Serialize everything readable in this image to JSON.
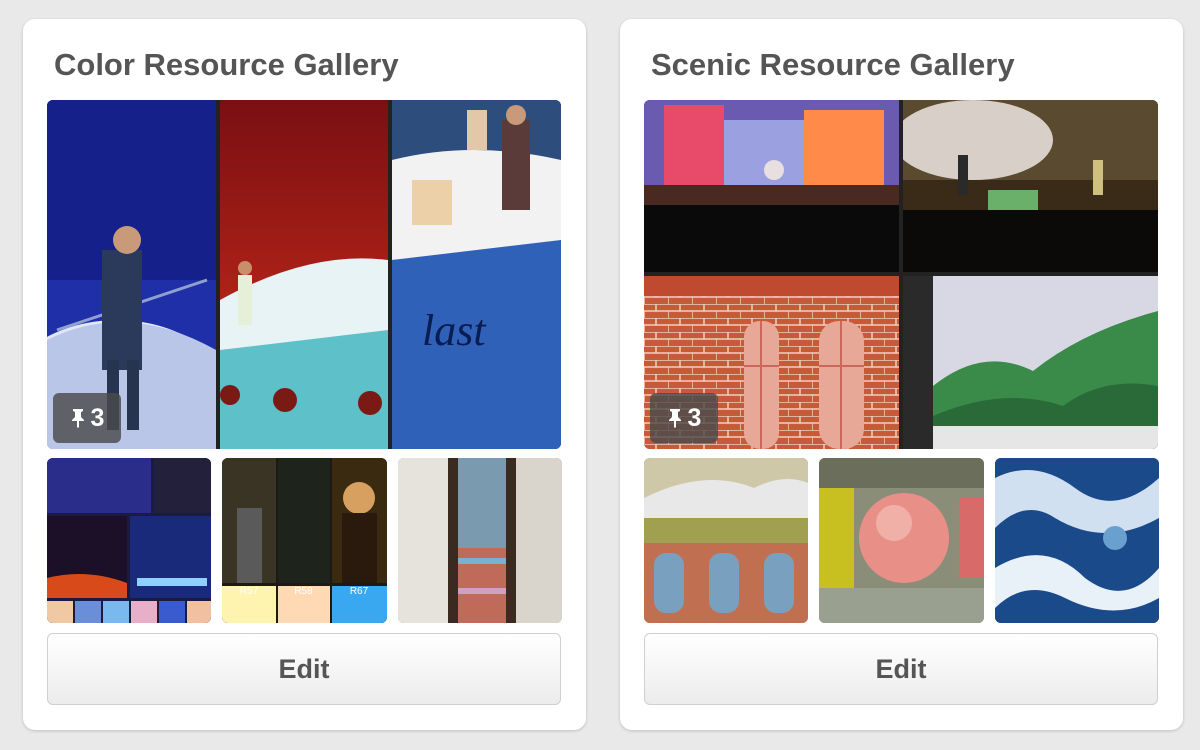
{
  "boards": [
    {
      "title": "Color Resource Gallery",
      "pin_count": "3",
      "edit_label": "Edit",
      "swatch_labels": [
        "R57",
        "R58",
        "R67"
      ]
    },
    {
      "title": "Scenic Resource Gallery",
      "pin_count": "3",
      "edit_label": "Edit"
    }
  ],
  "icons": {
    "pin": "pushpin-icon"
  },
  "colors": {
    "page_bg": "#e9e9e9",
    "card_bg": "#ffffff",
    "title": "#555555",
    "badge_bg": "#4b4b4b"
  }
}
